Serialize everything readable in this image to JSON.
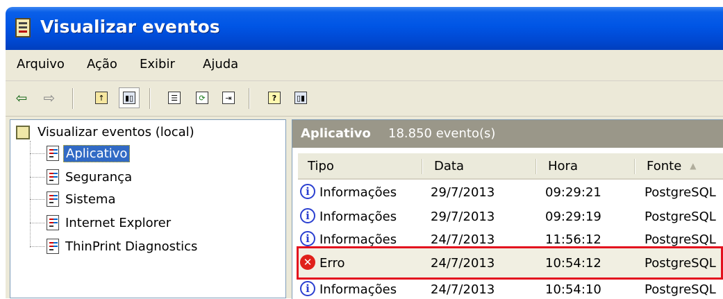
{
  "window": {
    "title": "Visualizar eventos"
  },
  "menu": [
    "Arquivo",
    "Ação",
    "Exibir",
    "Ajuda"
  ],
  "toolbar": {
    "buttons": [
      "back-arrow-icon",
      "forward-arrow-icon",
      "up-folder-icon",
      "show-hide-tree-icon",
      "properties-icon",
      "refresh-icon",
      "export-list-icon",
      "help-icon",
      "action-pane-icon"
    ]
  },
  "tree": {
    "root": "Visualizar eventos (local)",
    "items": [
      "Aplicativo",
      "Segurança",
      "Sistema",
      "Internet Explorer",
      "ThinPrint Diagnostics"
    ],
    "selected": "Aplicativo"
  },
  "list": {
    "title": "Aplicativo",
    "count": "18.850 evento(s)",
    "columns": [
      "Tipo",
      "Data",
      "Hora",
      "Fonte"
    ],
    "rows": [
      {
        "tipo": "Informações",
        "data": "29/7/2013",
        "hora": "09:29:21",
        "fonte": "PostgreSQL",
        "icon": "info-icon"
      },
      {
        "tipo": "Informações",
        "data": "29/7/2013",
        "hora": "09:29:19",
        "fonte": "PostgreSQL",
        "icon": "info-icon"
      },
      {
        "tipo": "Informações",
        "data": "24/7/2013",
        "hora": "11:56:12",
        "fonte": "PostgreSQL",
        "icon": "info-icon"
      },
      {
        "tipo": "Erro",
        "data": "24/7/2013",
        "hora": "10:54:12",
        "fonte": "PostgreSQL",
        "icon": "error-icon"
      },
      {
        "tipo": "Informações",
        "data": "24/7/2013",
        "hora": "10:54:10",
        "fonte": "PostgreSQL",
        "icon": "info-icon"
      }
    ]
  },
  "colors": {
    "titlebar": "#0055e5",
    "selection": "#316ac5",
    "highlight": "#e3101e",
    "header_bar": "#9a9789"
  }
}
